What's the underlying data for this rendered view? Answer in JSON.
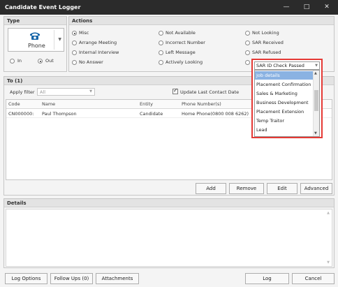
{
  "window": {
    "title": "Candidate Event Logger",
    "minimize_icon": "minimize-icon",
    "maximize_icon": "maximize-icon",
    "close_icon": "close-icon",
    "minimize_glyph": "—",
    "maximize_glyph": "□",
    "close_glyph": "✕"
  },
  "type_section": {
    "header": "Type",
    "selected_type": "Phone",
    "icon": "phone-icon",
    "direction": [
      {
        "label": "In",
        "checked": false
      },
      {
        "label": "Out",
        "checked": true
      }
    ]
  },
  "actions_section": {
    "header": "Actions",
    "options": [
      {
        "label": "Misc",
        "checked": true
      },
      {
        "label": "Arrange Meeting",
        "checked": false
      },
      {
        "label": "Internal Interview",
        "checked": false
      },
      {
        "label": "No Answer",
        "checked": false
      },
      {
        "label": "Not Available",
        "checked": false
      },
      {
        "label": "Incorrect Number",
        "checked": false
      },
      {
        "label": "Left Message",
        "checked": false
      },
      {
        "label": "Actively Looking",
        "checked": false
      },
      {
        "label": "Not Looking",
        "checked": false
      },
      {
        "label": "SAR Received",
        "checked": false
      },
      {
        "label": "SAR Refused",
        "checked": false
      },
      {
        "label": "",
        "checked": false
      }
    ]
  },
  "to_section": {
    "header": "To (1)",
    "filter_label": "Apply filter",
    "filter_value": "All",
    "update_contact_label": "Update Last Contact Date",
    "update_contact_checked": true,
    "columns": [
      "Code",
      "Name",
      "Entity",
      "Phone Number(s)"
    ],
    "rows": [
      [
        "CN000000:",
        "Paul Thompson",
        "Candidate",
        "Home Phone(0800 008 6262)"
      ]
    ],
    "buttons": {
      "add": "Add",
      "remove": "Remove",
      "edit": "Edit",
      "advanced": "Advanced"
    }
  },
  "details_section": {
    "header": "Details"
  },
  "footer": {
    "log_options": "Log Options",
    "follow_ups": "Follow Ups (0)",
    "attachments": "Attachments",
    "log": "Log",
    "cancel": "Cancel"
  },
  "dropdown": {
    "selected": "SAR ID Check Passed",
    "items": [
      "Job details",
      "Placement Confirmation",
      "Sales & Marketing",
      "Business Development",
      "Placement Extension",
      "Temp Traitor",
      "Lead"
    ],
    "highlighted_index": 0,
    "highlight_color": "#8ab2e2",
    "border_color": "#e53935"
  },
  "colors": {
    "titlebar": "#2b2b2b",
    "phone_icon": "#1565a8",
    "highlight": "#8ab2e2",
    "dropdown_border": "#e53935"
  }
}
